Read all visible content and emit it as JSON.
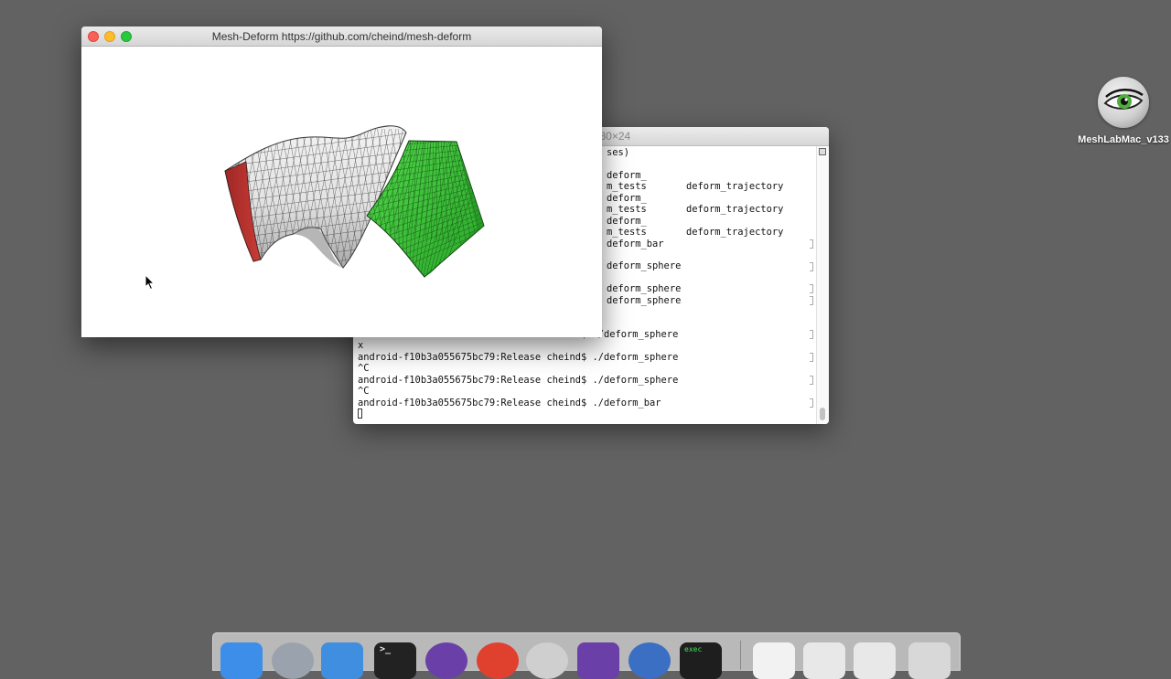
{
  "viewer": {
    "title": "Mesh-Deform https://github.com/cheind/mesh-deform"
  },
  "terminal": {
    "title": "m_bar — 80×24",
    "lines": [
      {
        "text": "ses)",
        "col2": ""
      },
      {
        "text": "",
        "col2": ""
      },
      {
        "text": "deform_",
        "col2": ""
      },
      {
        "text": "m_tests",
        "col2": "deform_trajectory"
      },
      {
        "text": "deform_",
        "col2": ""
      },
      {
        "text": "m_tests",
        "col2": "deform_trajectory"
      },
      {
        "text": "deform_",
        "col2": ""
      },
      {
        "text": "m_tests",
        "col2": "deform_trajectory"
      },
      {
        "text": "deform_bar",
        "col2": ""
      },
      {
        "text": "",
        "col2": ""
      },
      {
        "text": "deform_sphere",
        "col2": ""
      },
      {
        "text": "",
        "col2": ""
      },
      {
        "text": "deform_sphere",
        "col2": ""
      },
      {
        "text": "deform_sphere",
        "col2": ""
      },
      {
        "text": "",
        "col2": ""
      },
      {
        "text": "",
        "col2": ""
      },
      {
        "text": "android-f10b3a055675bc79:Release cheind$ ./deform_sphere",
        "col2": ""
      },
      {
        "text": "x",
        "col2": ""
      },
      {
        "text": "android-f10b3a055675bc79:Release cheind$ ./deform_sphere",
        "col2": ""
      },
      {
        "text": "^C",
        "col2": ""
      },
      {
        "text": "android-f10b3a055675bc79:Release cheind$ ./deform_sphere",
        "col2": ""
      },
      {
        "text": "^C",
        "col2": ""
      },
      {
        "text": "android-f10b3a055675bc79:Release cheind$ ./deform_bar",
        "col2": ""
      }
    ]
  },
  "desktop_icon": {
    "label": "MeshLabMac_v133",
    "icon": "meshlab-eye-icon"
  },
  "dock": {
    "items": [
      {
        "name": "finder-icon",
        "color": "#3d8ee8"
      },
      {
        "name": "launchpad-icon",
        "color": "#9aa3ad"
      },
      {
        "name": "xcode-icon",
        "color": "#3f8ee0"
      },
      {
        "name": "terminal-icon",
        "color": "#222222"
      },
      {
        "name": "github-desktop-icon",
        "color": "#6a3fa8"
      },
      {
        "name": "chrome-icon",
        "color": "#e0412f"
      },
      {
        "name": "meshlab-icon",
        "color": "#cfcfcf"
      },
      {
        "name": "visual-studio-icon",
        "color": "#6a3fa8"
      },
      {
        "name": "quicktime-icon",
        "color": "#3a6fc4"
      },
      {
        "name": "exec-icon",
        "color": "#1e1e1e"
      },
      {
        "name": "document-icon",
        "color": "#f2f2f2"
      },
      {
        "name": "screenshot-icon",
        "color": "#e8e8e8"
      },
      {
        "name": "window-icon",
        "color": "#e8e8e8"
      },
      {
        "name": "trash-icon",
        "color": "#d8d8d8"
      }
    ],
    "terminal_glyph": ">_",
    "exec_label": "exec"
  },
  "colors": {
    "desktop": "#626262",
    "mesh_green": "#3ec63a",
    "mesh_red": "#b8302c",
    "mesh_white": "#e9e9e9"
  }
}
